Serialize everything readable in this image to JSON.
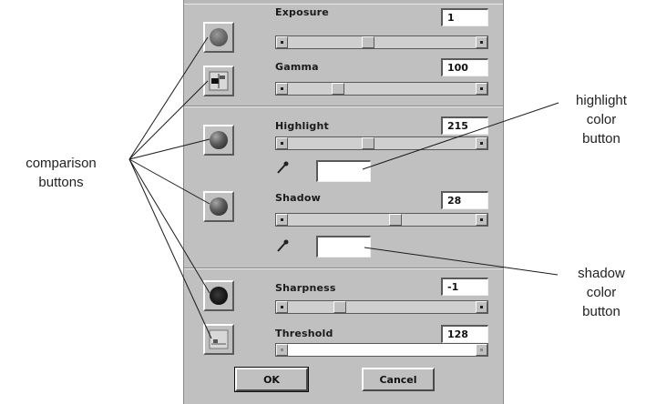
{
  "dialog": {
    "sliders": [
      {
        "label": "Exposure",
        "value": "1",
        "level": 0.42
      },
      {
        "label": "Gamma",
        "value": "100",
        "level": 0.25
      },
      {
        "label": "Highlight",
        "value": "215",
        "level": 0.42
      },
      {
        "label": "Shadow",
        "value": "28",
        "level": 0.58
      },
      {
        "label": "Sharpness",
        "value": "-1",
        "level": 0.26
      },
      {
        "label": "Threshold",
        "value": "128",
        "level": null
      }
    ],
    "ok_label": "OK",
    "cancel_label": "Cancel"
  },
  "annotations": {
    "comparison_line1": "comparison",
    "comparison_line2": "buttons",
    "highlight_line1": "highlight",
    "highlight_line2": "color",
    "highlight_line3": "button",
    "shadow_line1": "shadow",
    "shadow_line2": "color",
    "shadow_line3": "button"
  },
  "icons": {
    "comparison": "sphere-icon",
    "color_picker": "eyedropper-icon"
  },
  "colors": {
    "dialog_bg": "#c0c0c0",
    "swatch": "#ffffff"
  }
}
